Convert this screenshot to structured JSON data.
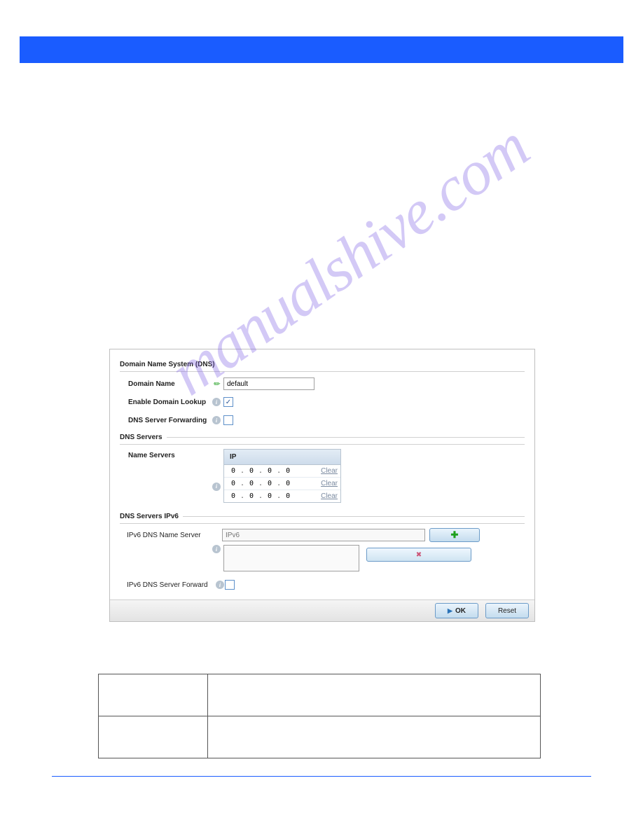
{
  "panel": {
    "section1_title": "Domain Name System (DNS)",
    "domain_name_label": "Domain Name",
    "domain_name_value": "default",
    "enable_lookup_label": "Enable Domain Lookup",
    "enable_lookup_checked": "✓",
    "dns_forward_label": "DNS Server Forwarding",
    "section2_title": "DNS Servers",
    "name_servers_label": "Name Servers",
    "ip_header": "IP",
    "ip_rows": [
      {
        "q1": "0",
        "q2": "0",
        "q3": "0",
        "q4": "0",
        "clear": "Clear"
      },
      {
        "q1": "0",
        "q2": "0",
        "q3": "0",
        "q4": "0",
        "clear": "Clear"
      },
      {
        "q1": "0",
        "q2": "0",
        "q3": "0",
        "q4": "0",
        "clear": "Clear"
      }
    ],
    "section3_title": "DNS Servers IPv6",
    "ipv6_name_label": "IPv6 DNS Name Server",
    "ipv6_placeholder": "IPv6",
    "ipv6_forward_label": "IPv6 DNS Server Forward",
    "ok_label": "OK",
    "reset_label": "Reset"
  }
}
